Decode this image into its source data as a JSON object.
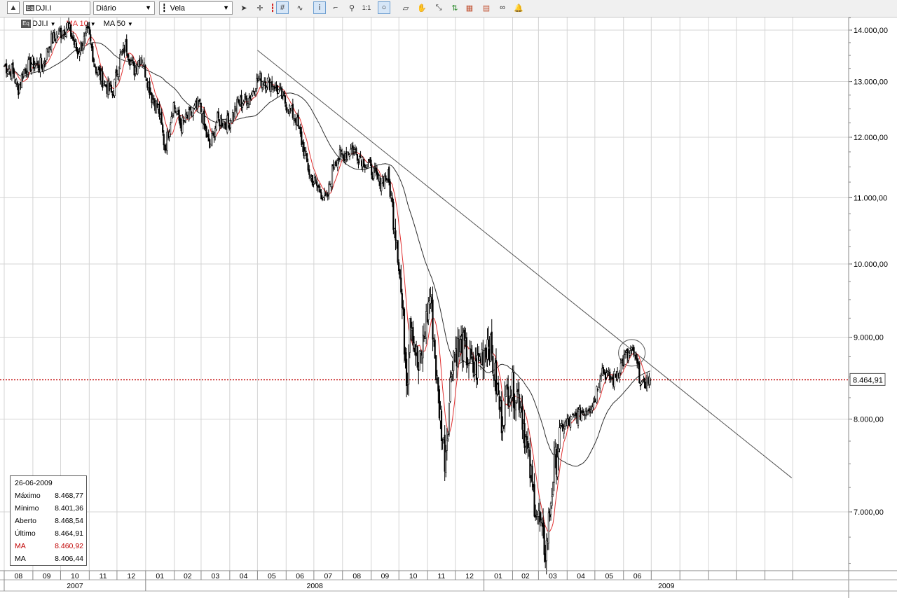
{
  "toolbar": {
    "symbol_icon_label": "Eq",
    "symbol_value": "DJI.I",
    "period_value": "Diário",
    "chart_type_value": "Vela",
    "buttons": [
      "cursor-arrow",
      "crosshair",
      "candle-highlight",
      "grid",
      "wave",
      "info",
      "properties",
      "zoom",
      "one-to-one",
      "circle",
      "eraser",
      "hand",
      "line-tool",
      "compare",
      "layers",
      "link",
      "alert"
    ]
  },
  "legend": {
    "eq_label": "Eq",
    "symbol": "DJI.I",
    "ma10": "MA 10",
    "ma50": "MA 50"
  },
  "colors": {
    "ma10": "#e03030",
    "ma50": "#303030",
    "last_price_line": "#c00000",
    "grid": "#d4d4d4"
  },
  "infobox": {
    "date": "26-06-2009",
    "rows": [
      {
        "label": "Máximo",
        "value": "8.468,77"
      },
      {
        "label": "Mínimo",
        "value": "8.401,36"
      },
      {
        "label": "Aberto",
        "value": "8.468,54"
      },
      {
        "label": "Último",
        "value": "8.464,91"
      },
      {
        "label": "MA",
        "value": "8.460,92"
      },
      {
        "label": "MA",
        "value": "8.406,44"
      }
    ]
  },
  "chart_data": {
    "type": "candlestick",
    "symbol": "DJI.I",
    "period": "Diário",
    "log_scale": true,
    "ylim": [
      6450,
      14400
    ],
    "y_ticks": [
      {
        "value": 14000,
        "label": "14.000,00"
      },
      {
        "value": 13000,
        "label": "13.000,00"
      },
      {
        "value": 12000,
        "label": "12.000,00"
      },
      {
        "value": 11000,
        "label": "11.000,00"
      },
      {
        "value": 10000,
        "label": "10.000,00"
      },
      {
        "value": 9000,
        "label": "9.000,00"
      },
      {
        "value": 8000,
        "label": "8.000,00"
      },
      {
        "value": 7000,
        "label": "7.000,00"
      }
    ],
    "last_price": {
      "value": 8464.91,
      "label": "8.464,91"
    },
    "months": [
      "08",
      "09",
      "10",
      "11",
      "12",
      "01",
      "02",
      "03",
      "04",
      "05",
      "06",
      "07",
      "08",
      "09",
      "10",
      "11",
      "12",
      "01",
      "02",
      "03",
      "04",
      "05",
      "06"
    ],
    "years": [
      "2007",
      "2008",
      "2009"
    ],
    "price_path": [
      [
        "2007-08-01",
        13300
      ],
      [
        "2007-08-10",
        13200
      ],
      [
        "2007-08-16",
        12850
      ],
      [
        "2007-08-22",
        13200
      ],
      [
        "2007-08-31",
        13350
      ],
      [
        "2007-09-12",
        13300
      ],
      [
        "2007-09-20",
        13780
      ],
      [
        "2007-10-01",
        13950
      ],
      [
        "2007-10-09",
        14100
      ],
      [
        "2007-10-19",
        13550
      ],
      [
        "2007-10-31",
        13950
      ],
      [
        "2007-11-08",
        13250
      ],
      [
        "2007-11-20",
        12900
      ],
      [
        "2007-11-26",
        12750
      ],
      [
        "2007-12-04",
        13450
      ],
      [
        "2007-12-11",
        13700
      ],
      [
        "2007-12-19",
        13200
      ],
      [
        "2007-12-27",
        13500
      ],
      [
        "2008-01-08",
        12700
      ],
      [
        "2008-01-15",
        12500
      ],
      [
        "2008-01-22",
        11800
      ],
      [
        "2008-01-31",
        12600
      ],
      [
        "2008-02-08",
        12200
      ],
      [
        "2008-02-19",
        12400
      ],
      [
        "2008-02-28",
        12600
      ],
      [
        "2008-03-10",
        11800
      ],
      [
        "2008-03-18",
        12300
      ],
      [
        "2008-03-31",
        12250
      ],
      [
        "2008-04-10",
        12600
      ],
      [
        "2008-04-22",
        12700
      ],
      [
        "2008-05-02",
        13050
      ],
      [
        "2008-05-19",
        12950
      ],
      [
        "2008-05-30",
        12650
      ],
      [
        "2008-06-12",
        12300
      ],
      [
        "2008-06-27",
        11350
      ],
      [
        "2008-07-15",
        10950
      ],
      [
        "2008-07-23",
        11600
      ],
      [
        "2008-08-11",
        11800
      ],
      [
        "2008-08-28",
        11550
      ],
      [
        "2008-09-10",
        11250
      ],
      [
        "2008-09-19",
        11350
      ],
      [
        "2008-09-29",
        10400
      ],
      [
        "2008-10-10",
        8450
      ],
      [
        "2008-10-13",
        9400
      ],
      [
        "2008-10-22",
        8550
      ],
      [
        "2008-10-28",
        9000
      ],
      [
        "2008-11-04",
        9600
      ],
      [
        "2008-11-12",
        8300
      ],
      [
        "2008-11-20",
        7550
      ],
      [
        "2008-11-28",
        8800
      ],
      [
        "2008-12-08",
        8900
      ],
      [
        "2008-12-22",
        8550
      ],
      [
        "2009-01-06",
        9000
      ],
      [
        "2009-01-20",
        8000
      ],
      [
        "2009-01-28",
        8400
      ],
      [
        "2009-02-09",
        8250
      ],
      [
        "2009-02-23",
        7200
      ],
      [
        "2009-03-09",
        6600
      ],
      [
        "2009-03-17",
        7400
      ],
      [
        "2009-03-26",
        7900
      ],
      [
        "2009-04-14",
        8050
      ],
      [
        "2009-04-30",
        8200
      ],
      [
        "2009-05-08",
        8600
      ],
      [
        "2009-05-20",
        8450
      ],
      [
        "2009-06-03",
        8750
      ],
      [
        "2009-06-12",
        8800
      ],
      [
        "2009-06-22",
        8350
      ],
      [
        "2009-06-26",
        8465
      ]
    ],
    "trendline": {
      "start": [
        "2008-05-01",
        13600
      ],
      "end": [
        "2009-11-30",
        7350
      ]
    },
    "highlight_circle": {
      "date": "2009-06-10",
      "value": 8800
    }
  }
}
